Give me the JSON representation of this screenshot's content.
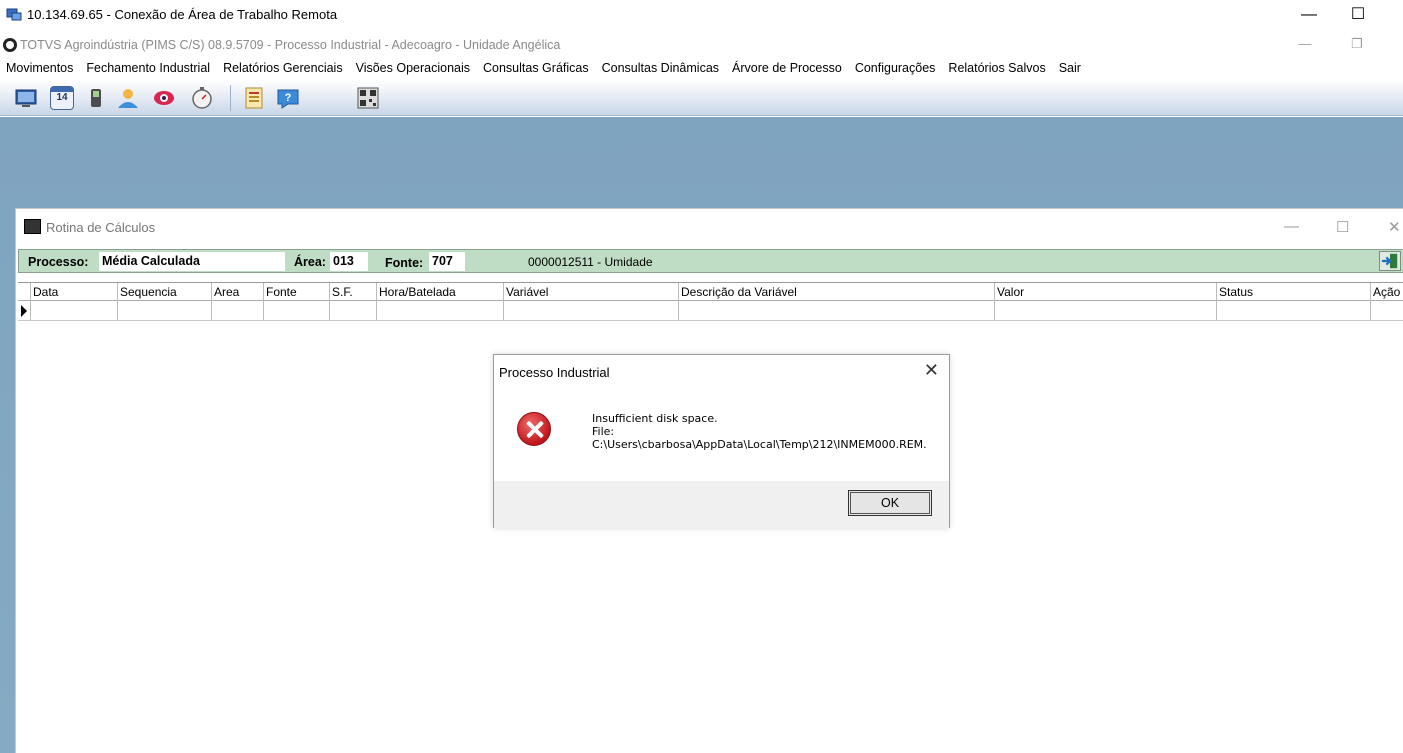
{
  "rdp": {
    "title": "10.134.69.65 - Conexão de Área de Trabalho Remota",
    "minimize": "—",
    "maximize": "☐"
  },
  "app": {
    "title": "TOTVS Agroindústria (PIMS C/S) 08.9.5709 - Processo Industrial  -  Adecoagro - Unidade Angélica",
    "minimize": "—",
    "restore": "❐"
  },
  "menu": [
    "Movimentos",
    "Fechamento Industrial",
    "Relatórios Gerenciais",
    "Visões Operacionais",
    "Consultas Gráficas",
    "Consultas Dinâmicas",
    "Árvore de Processo",
    "Configurações",
    "Relatórios Salvos",
    "Sair"
  ],
  "toolbar_icons": [
    "monitor-icon",
    "calendar-icon",
    "device-icon",
    "users-icon",
    "eye-icon",
    "stopwatch-icon",
    "report-icon",
    "help-icon",
    "qr-icon"
  ],
  "calendar_day": "14",
  "mdi": {
    "title": "Rotina de Cálculos",
    "minimize": "—",
    "maximize": "☐",
    "close": "✕"
  },
  "header": {
    "processo_label": "Processo:",
    "processo_value": "Média Calculada",
    "area_label": "Área:",
    "area_value": "013",
    "fonte_label": "Fonte:",
    "fonte_value": "707",
    "variable": "0000012511 - Umidade"
  },
  "grid": {
    "columns": [
      "Data",
      "Sequencia",
      "Area",
      "Fonte",
      "S.F.",
      "Hora/Batelada",
      "Variável",
      "Descrição da Variável",
      "Valor",
      "Status",
      "Ação"
    ]
  },
  "dialog": {
    "title": "Processo Industrial",
    "close": "✕",
    "line1": "Insufficient disk space.",
    "line2": "File:",
    "line3": "C:\\Users\\cbarbosa\\AppData\\Local\\Temp\\212\\INMEM000.REM.",
    "ok": "OK"
  }
}
